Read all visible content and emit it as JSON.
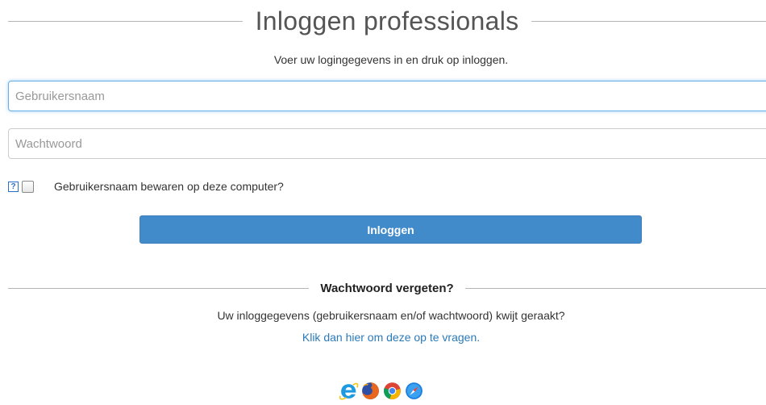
{
  "header": {
    "title": "Inloggen professionals"
  },
  "intro": {
    "text": "Voer uw logingegevens in en druk op inloggen."
  },
  "form": {
    "username_placeholder": "Gebruikersnaam",
    "password_placeholder": "Wachtwoord",
    "help_symbol": "?",
    "remember_label": "Gebruikersnaam bewaren op deze computer?",
    "remember_checked": false,
    "submit_label": "Inloggen"
  },
  "forgot": {
    "heading": "Wachtwoord vergeten?",
    "text": "Uw inloggegevens (gebruikersnaam en/of wachtwoord) kwijt geraakt?",
    "link_text": "Klik dan hier om deze op te vragen."
  },
  "browsers": [
    "internet-explorer-icon",
    "firefox-icon",
    "chrome-icon",
    "safari-icon"
  ],
  "colors": {
    "primary_button": "#428bca",
    "link": "#2a7ab9",
    "focus_border": "#66afe9"
  }
}
